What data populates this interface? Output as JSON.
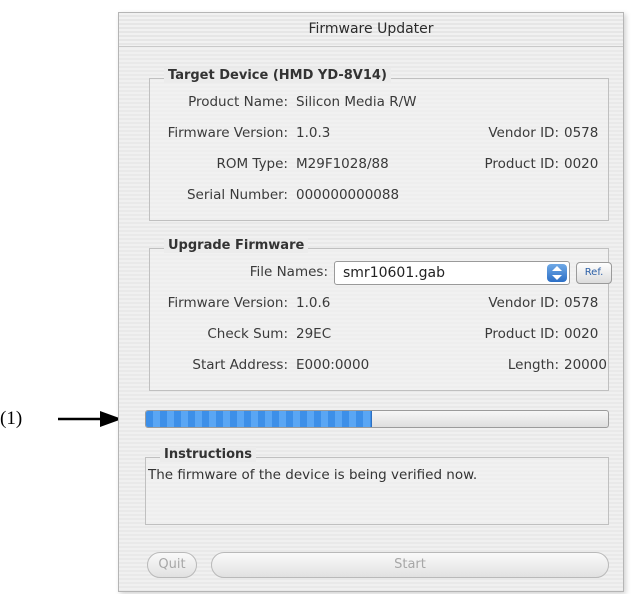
{
  "window": {
    "title": "Firmware Updater"
  },
  "annotation": {
    "label": "(1)"
  },
  "target_device": {
    "title": "Target Device (HMD YD-8V14)",
    "product_name_label": "Product Name:",
    "product_name_value": "Silicon Media R/W",
    "firmware_version_label": "Firmware Version:",
    "firmware_version_value": "1.0.3",
    "vendor_id_label": "Vendor ID:",
    "vendor_id_value": "0578",
    "rom_type_label": "ROM Type:",
    "rom_type_value": "M29F1028/88",
    "product_id_label": "Product ID:",
    "product_id_value": "0020",
    "serial_number_label": "Serial Number:",
    "serial_number_value": "000000000088"
  },
  "upgrade_firmware": {
    "title": "Upgrade Firmware",
    "file_names_label": "File Names:",
    "file_names_value": "smr10601.gab",
    "ref_button_label": "Ref.",
    "firmware_version_label": "Firmware Version:",
    "firmware_version_value": "1.0.6",
    "vendor_id_label": "Vendor ID:",
    "vendor_id_value": "0578",
    "check_sum_label": "Check Sum:",
    "check_sum_value": "29EC",
    "product_id_label": "Product ID:",
    "product_id_value": "0020",
    "start_address_label": "Start Address:",
    "start_address_value": "E000:0000",
    "length_label": "Length:",
    "length_value": "20000"
  },
  "progress": {
    "fraction": 0.49
  },
  "instructions": {
    "title": "Instructions",
    "text": "The firmware of the device is being verified now."
  },
  "buttons": {
    "quit_label": "Quit",
    "start_label": "Start"
  },
  "colors": {
    "progress_fill": "#3d8fe8",
    "accent": "#2c6fc6"
  },
  "icons": {
    "file_select_arrows": "updown-arrows-icon",
    "annotation_arrow": "arrow-right-icon"
  }
}
